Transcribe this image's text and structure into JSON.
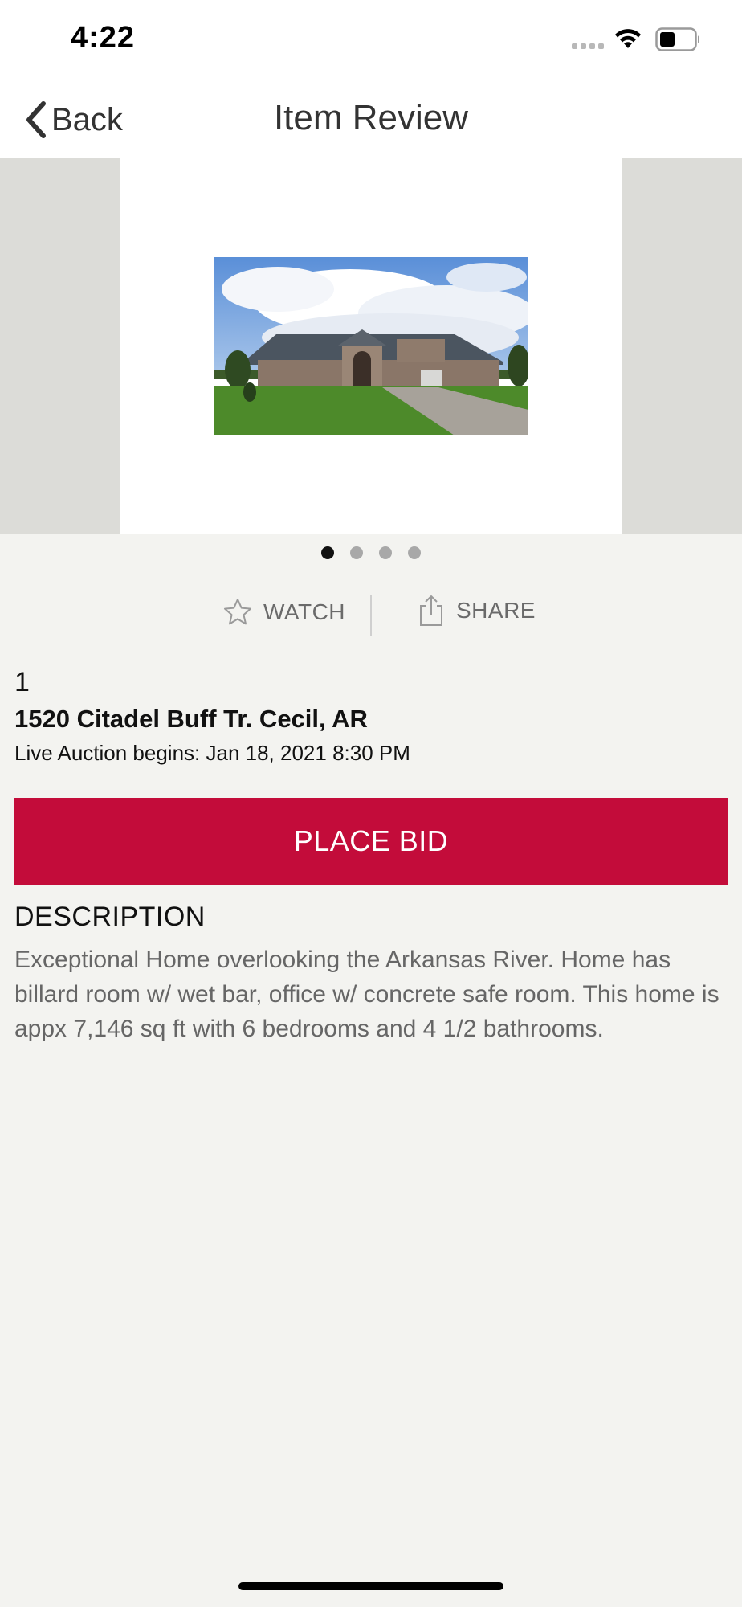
{
  "status_bar": {
    "time": "4:22",
    "icons": [
      "cellular-icon",
      "wifi-icon",
      "battery-icon"
    ]
  },
  "nav": {
    "back_label": "Back",
    "title": "Item Review"
  },
  "carousel": {
    "image_description": "house-photo",
    "page_count": 4,
    "active_page": 1
  },
  "actions": {
    "watch_label": "WATCH",
    "share_label": "SHARE"
  },
  "item": {
    "lot_number": "1",
    "title": "1520 Citadel Buff Tr. Cecil, AR",
    "auction_line": "Live Auction begins: Jan 18, 2021 8:30 PM"
  },
  "bid": {
    "button_label": "PLACE BID"
  },
  "description": {
    "heading": "DESCRIPTION",
    "body": "Exceptional Home overlooking the Arkansas River. Home has billard room w/ wet bar, office w/ concrete safe room. This home is appx 7,146 sq ft with 6 bedrooms and 4 1/2 bathrooms."
  },
  "colors": {
    "accent": "#c30c3a",
    "background": "#f3f3f0",
    "carousel_side": "#dcdcd8"
  }
}
